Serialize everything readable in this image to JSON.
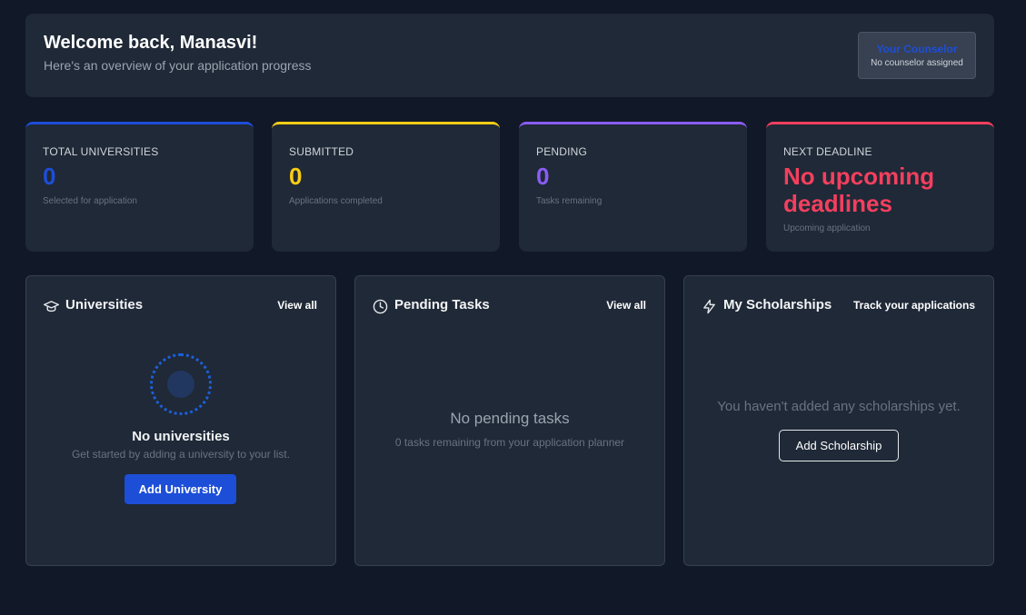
{
  "header": {
    "title": "Welcome back, Manasvi!",
    "subtitle": "Here's an overview of your application progress",
    "counselor": {
      "title": "Your Counselor",
      "status": "No counselor assigned"
    }
  },
  "stats": [
    {
      "label": "TOTAL UNIVERSITIES",
      "value": "0",
      "caption": "Selected for application",
      "color": "#1d4ed8"
    },
    {
      "label": "SUBMITTED",
      "value": "0",
      "caption": "Applications completed",
      "color": "#facc15"
    },
    {
      "label": "PENDING",
      "value": "0",
      "caption": "Tasks remaining",
      "color": "#8b5cf6"
    },
    {
      "label": "NEXT DEADLINE",
      "value": "No upcoming deadlines",
      "caption": "Upcoming application",
      "color": "#f43f5e"
    }
  ],
  "universities": {
    "icon": "graduation-cap-icon",
    "title": "Universities",
    "link": "View all",
    "empty_title": "No universities",
    "empty_sub": "Get started by adding a university to your list.",
    "button": "Add University"
  },
  "tasks": {
    "icon": "clock-icon",
    "title": "Pending Tasks",
    "link": "View all",
    "empty_title": "No pending tasks",
    "empty_sub": "0 tasks remaining from your application planner"
  },
  "scholarships": {
    "icon": "lightning-icon",
    "title": "My Scholarships",
    "link": "Track your applications",
    "empty_text": "You haven't added any scholarships yet.",
    "button": "Add Scholarship"
  }
}
